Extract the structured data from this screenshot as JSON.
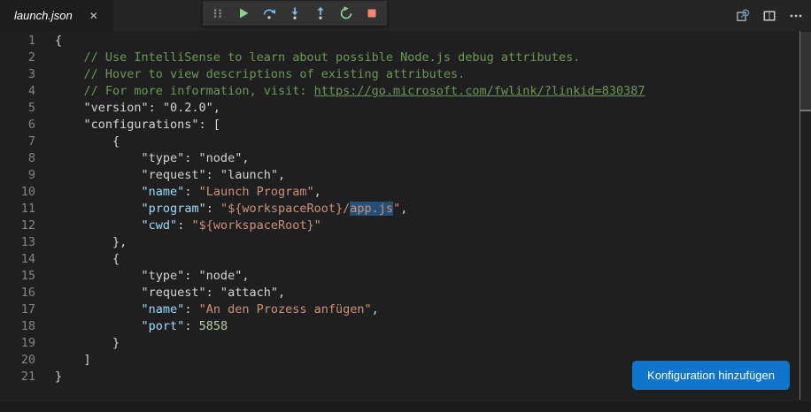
{
  "tabbar": {
    "tabs": [
      {
        "label": "launch.json",
        "close_icon": "✕",
        "preview_italic": true
      }
    ],
    "actions": [
      {
        "name": "search-editor"
      },
      {
        "name": "split-editor"
      },
      {
        "name": "more-actions"
      }
    ]
  },
  "debug_toolbar": {
    "buttons": [
      {
        "name": "gripper"
      },
      {
        "name": "continue"
      },
      {
        "name": "step-over"
      },
      {
        "name": "step-into"
      },
      {
        "name": "step-out"
      },
      {
        "name": "restart"
      },
      {
        "name": "stop"
      }
    ]
  },
  "editor": {
    "language": "json",
    "selected_text": "app.js",
    "lines": [
      {
        "n": "1",
        "segs": [
          {
            "c": "punct",
            "t": "{"
          }
        ]
      },
      {
        "n": "2",
        "segs": [
          {
            "c": "comment",
            "t": "    // Use IntelliSense to learn about possible Node.js debug attributes."
          }
        ]
      },
      {
        "n": "3",
        "segs": [
          {
            "c": "comment",
            "t": "    // Hover to view descriptions of existing attributes."
          }
        ]
      },
      {
        "n": "4",
        "segs": [
          {
            "c": "comment",
            "t": "    // For more information, visit: "
          },
          {
            "c": "link",
            "t": "https://go.microsoft.com/fwlink/?linkid=830387"
          }
        ]
      },
      {
        "n": "5",
        "segs": [
          {
            "c": "plain",
            "t": "    \"version\": \"0.2.0\","
          }
        ]
      },
      {
        "n": "6",
        "segs": [
          {
            "c": "plain",
            "t": "    \"configurations\": ["
          }
        ]
      },
      {
        "n": "7",
        "segs": [
          {
            "c": "punct",
            "t": "        {"
          }
        ]
      },
      {
        "n": "8",
        "segs": [
          {
            "c": "plain",
            "t": "            \"type\": \"node\","
          }
        ]
      },
      {
        "n": "9",
        "segs": [
          {
            "c": "plain",
            "t": "            \"request\": \"launch\","
          }
        ]
      },
      {
        "n": "10",
        "segs": [
          {
            "c": "punct",
            "t": "            "
          },
          {
            "c": "key",
            "t": "\"name\""
          },
          {
            "c": "punct",
            "t": ": "
          },
          {
            "c": "str",
            "t": "\"Launch Program\""
          },
          {
            "c": "punct",
            "t": ","
          }
        ]
      },
      {
        "n": "11",
        "segs": [
          {
            "c": "punct",
            "t": "            "
          },
          {
            "c": "key",
            "t": "\"program\""
          },
          {
            "c": "punct",
            "t": ": "
          },
          {
            "c": "str",
            "t": "\"${workspaceRoot}/"
          },
          {
            "c": "str-sel",
            "t": "app.js"
          },
          {
            "c": "str",
            "t": "\""
          },
          {
            "c": "punct",
            "t": ","
          }
        ]
      },
      {
        "n": "12",
        "segs": [
          {
            "c": "punct",
            "t": "            "
          },
          {
            "c": "key",
            "t": "\"cwd\""
          },
          {
            "c": "punct",
            "t": ": "
          },
          {
            "c": "str",
            "t": "\"${workspaceRoot}\""
          }
        ]
      },
      {
        "n": "13",
        "segs": [
          {
            "c": "punct",
            "t": "        },"
          }
        ]
      },
      {
        "n": "14",
        "segs": [
          {
            "c": "punct",
            "t": "        {"
          }
        ]
      },
      {
        "n": "15",
        "segs": [
          {
            "c": "plain",
            "t": "            \"type\": \"node\","
          }
        ]
      },
      {
        "n": "16",
        "segs": [
          {
            "c": "plain",
            "t": "            \"request\": \"attach\","
          }
        ]
      },
      {
        "n": "17",
        "segs": [
          {
            "c": "punct",
            "t": "            "
          },
          {
            "c": "key",
            "t": "\"name\""
          },
          {
            "c": "punct",
            "t": ": "
          },
          {
            "c": "str",
            "t": "\"An den Prozess anfügen\""
          },
          {
            "c": "punct",
            "t": ","
          }
        ]
      },
      {
        "n": "18",
        "segs": [
          {
            "c": "punct",
            "t": "            "
          },
          {
            "c": "key",
            "t": "\"port\""
          },
          {
            "c": "punct",
            "t": ": "
          },
          {
            "c": "num",
            "t": "5858"
          }
        ]
      },
      {
        "n": "19",
        "segs": [
          {
            "c": "punct",
            "t": "        }"
          }
        ]
      },
      {
        "n": "20",
        "segs": [
          {
            "c": "punct",
            "t": "    ]"
          }
        ]
      },
      {
        "n": "21",
        "segs": [
          {
            "c": "punct",
            "t": "}"
          }
        ]
      }
    ]
  },
  "actions_panel": {
    "add_configuration_label": "Konfiguration hinzufügen"
  },
  "colors": {
    "editor_bg": "#1f1f1f",
    "tabbar_bg": "#252526",
    "active_tab_bg": "#1d1d1d",
    "toolbar_bg": "#333333",
    "button_accent": "#0e74cc",
    "selection_bg": "#264f78",
    "comment_green": "#6a9955",
    "key_blue": "#9cdcfe",
    "string_orange": "#ce9178",
    "number_green": "#b5cea8",
    "plain_text": "#d4d4d4",
    "line_number": "#858585",
    "debug_play_green": "#89d185",
    "debug_step_blue": "#75beff",
    "debug_stop_red": "#f48771",
    "icon_gray": "#c5c5c5"
  }
}
